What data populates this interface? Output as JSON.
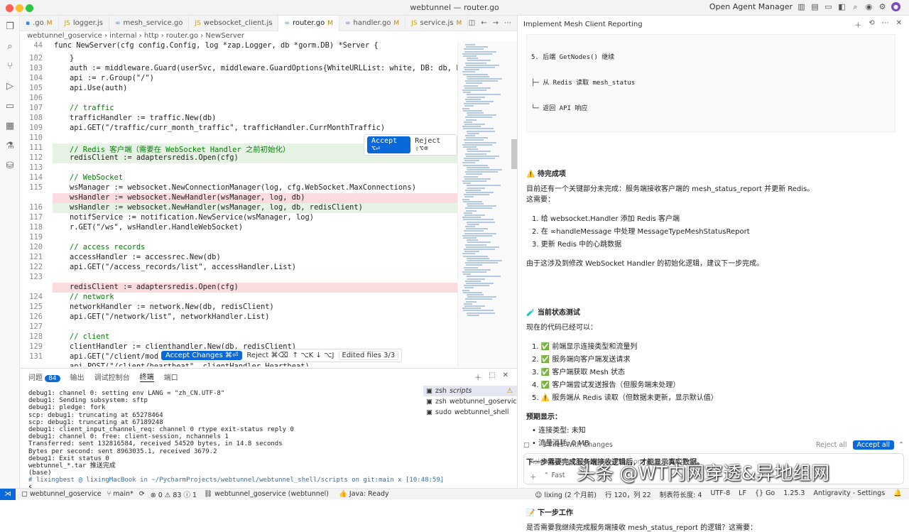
{
  "window": {
    "title": "webtunnel — router.go",
    "right_label": "Open Agent Manager"
  },
  "tabs": [
    {
      "label": ".go",
      "mod": "M"
    },
    {
      "label": "logger.js",
      "mod": ""
    },
    {
      "label": "mesh_service.go",
      "mod": ""
    },
    {
      "label": "websocket_client.js",
      "mod": ""
    },
    {
      "label": "router.go",
      "mod": "M"
    },
    {
      "label": "handler.go",
      "mod": "M"
    },
    {
      "label": "service.js",
      "mod": "M"
    }
  ],
  "breadcrumb": "webtunnel_goservice › internal › http › router.go › NewServer",
  "editor": {
    "line44_num": "44",
    "line44_code": "func NewServer(cfg config.Config, log *zap.Logger, db *gorm.DB) *Server {",
    "lines": [
      {
        "n": "102",
        "c": "\t}"
      },
      {
        "n": "103",
        "c": "\tauth := middleware.Guard(userSvc, middleware.GuardOptions{WhiteURLList: white, DB: db, Log: log})"
      },
      {
        "n": "104",
        "c": "\tapi := r.Group(\"/\")"
      },
      {
        "n": "105",
        "c": "\tapi.Use(auth)"
      },
      {
        "n": "106",
        "c": ""
      },
      {
        "n": "107",
        "c": "\t// traffic"
      },
      {
        "n": "108",
        "c": "\ttrafficHandler := traffic.New(db)"
      },
      {
        "n": "109",
        "c": "\tapi.GET(\"/traffic/curr_month_traffic\", trafficHandler.CurrMonthTraffic)"
      },
      {
        "n": "110",
        "c": ""
      },
      {
        "n": "111",
        "c": "\t// Redis 客户端（需要在 WebSocket Handler 之前初始化）"
      },
      {
        "n": "112",
        "c": "\tredisClient := adaptersredis.Open(cfg)"
      },
      {
        "n": "113",
        "c": ""
      },
      {
        "n": "114",
        "c": "\t// WebSocket"
      },
      {
        "n": "115",
        "c": "\twsManager := websocket.NewConnectionManager(log, cfg.WebSocket.MaxConnections)"
      },
      {
        "n": "",
        "c": "\twsHandler := websocket.NewHandler(wsManager, log, db)"
      },
      {
        "n": "116",
        "c": "\twsHandler := websocket.NewHandler(wsManager, log, db, redisClient)"
      },
      {
        "n": "117",
        "c": "\tnotifService := notification.NewService(wsManager, log)"
      },
      {
        "n": "118",
        "c": "\tr.GET(\"/ws\", wsHandler.HandleWebSocket)"
      },
      {
        "n": "119",
        "c": ""
      },
      {
        "n": "120",
        "c": "\t// access records"
      },
      {
        "n": "121",
        "c": "\taccessHandler := accessrec.New(db)"
      },
      {
        "n": "122",
        "c": "\tapi.GET(\"/access_records/list\", accessHandler.List)"
      },
      {
        "n": "123",
        "c": ""
      },
      {
        "n": "",
        "c": "\tredisClient := adaptersredis.Open(cfg)"
      },
      {
        "n": "124",
        "c": "\t// network"
      },
      {
        "n": "125",
        "c": "\tnetworkHandler := network.New(db, redisClient)"
      },
      {
        "n": "126",
        "c": "\tapi.GET(\"/network/list\", networkHandler.List)"
      },
      {
        "n": "127",
        "c": ""
      },
      {
        "n": "128",
        "c": "\t// client"
      },
      {
        "n": "129",
        "c": "\tclientHandler := clienthandler.New(db, redisClient)"
      },
      {
        "n": "131",
        "c": "\tapi.GET(\"/client/modif"
      },
      {
        "n": "",
        "c": "\tapi.POST(\"/client/heartbeat\", clientHandler.Heartbeat)"
      }
    ],
    "inline_accept": "Accept ⌥⏎",
    "inline_reject": "Reject ⇧⌥⌫",
    "accept_changes": "Accept Changes ⌘⏎",
    "reject": "Reject ⌘⌫",
    "nav": "↑ ⌥K  ↓ ⌥J",
    "edited_files": "Edited files 3/3"
  },
  "panel": {
    "tabs": [
      "问题",
      "输出",
      "调试控制台",
      "终端",
      "端口"
    ],
    "problems_count": "84",
    "terminal_lines": [
      "debug1: channel 0: setting env LANG = \"zh_CN.UTF-8\"",
      "debug1: Sending subsystem: sftp",
      "debug1: pledge: fork",
      "scp: debug1: truncating at 65278464",
      "scp: debug1: truncating at 67189248",
      "debug1: client_input_channel_req: channel 0 rtype exit-status reply 0",
      "debug1: channel 0: free: client-session, nchannels 1",
      "Transferred: sent 132816584, received 54520 bytes, in 14.8 seconds",
      "Bytes per second: sent 8963035.1, received 3679.2",
      "debug1: Exit status 0",
      "webtunnel_*.tar 推送完成",
      "(base)",
      "# lixingbest @ lixingMacBook in ~/PycharmProjects/webtunnel/webtunnel_shell/scripts on git:main x [10:48:59]",
      "$ "
    ],
    "terminals": [
      {
        "shell": "zsh",
        "name": "scripts"
      },
      {
        "shell": "zsh",
        "name": "webtunnel_goservice"
      },
      {
        "shell": "sudo",
        "name": "webtunnel_shell"
      }
    ]
  },
  "chat": {
    "title": "Implement Mesh Client Reporting",
    "step5": "5. 后端 GetNodes() 继续",
    "step5a": "├─ 从 Redis 读取 mesh_status",
    "step5b": "└─ 返回 API 响应",
    "pending_title": "⚠️ 待完成项",
    "pending_intro": "目前还有一个关键部分未完成：服务端接收客户端的 mesh_status_report 并更新 Redis。",
    "pending_need": "这需要：",
    "pending_items": [
      "给 websocket.Handler 添加 Redis 客户端",
      "在 ∞handleMessage 中处理 MessageTypeMeshStatusReport",
      "更新 Redis 中的心跳数据"
    ],
    "pending_note": "由于这涉及到修改 WebSocket Handler 的初始化逻辑，建议下一步完成。",
    "test_title": "🧪 当前状态测试",
    "test_intro": "现在的代码已经可以：",
    "test_items": [
      "✅ 前端显示连接类型和流量列",
      "✅ 服务端向客户端发送请求",
      "✅ 客户端获取 Mesh 状态",
      "✅ 客户端尝试发送报告（但服务端未处理）",
      "⚠️ 服务端从 Redis 读取（但数据未更新，显示默认值）"
    ],
    "expect_title": "预期显示：",
    "expect_items": [
      "连接类型: 未知",
      "流量消耗: 0 MB"
    ],
    "expect_note": "下一步需要完成服务端接收逻辑后，才能显示真实数据。",
    "next_title": "📝 下一步工作",
    "next_q": "是否需要我继续完成服务端接收 mesh_status_report 的逻辑？这需要：",
    "files_changed": "3 Files With Changes",
    "reject_all": "Reject all",
    "accept_all": "Accept all",
    "input_placeholder": "Ask anything (⌘L), @ to mention, / for workflows",
    "mode": "Fast"
  },
  "statusbar": {
    "project": "webtunnel_goservice",
    "branch": "main*",
    "counts": "⊗ 0 ⚠ 83 ⓘ 1",
    "workspace": "webtunnel_goservice (webtunnel)",
    "java": "Java: Ready",
    "blame": "lixing (2 个月前)",
    "pos": "行 120，列 22",
    "tab": "制表符长度: 4",
    "enc": "UTF-8",
    "eol": "LF",
    "lang": "Go",
    "ver": "1.25.3",
    "app": "Antigravity - Settings"
  },
  "watermark": "头条 @WT内网穿透&异地组网"
}
